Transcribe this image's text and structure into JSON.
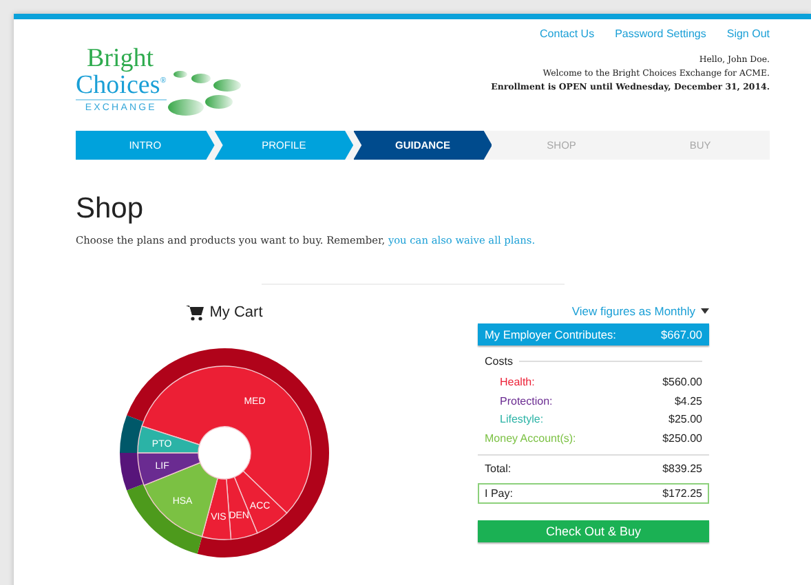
{
  "logo": {
    "line_1": "Bright",
    "line_2": "Choices",
    "mark": "®",
    "line_3": "EXCHANGE"
  },
  "top_links": [
    "Contact Us",
    "Password Settings",
    "Sign Out"
  ],
  "greeting": {
    "hello": "Hello, John Doe.",
    "welcome": "Welcome to the Bright Choices Exchange for ACME.",
    "enrollment": "Enrollment is OPEN until Wednesday, December 31, 2014."
  },
  "steps": [
    {
      "label": "INTRO",
      "kind": "done",
      "selected": false
    },
    {
      "label": "PROFILE",
      "kind": "done",
      "selected": false
    },
    {
      "label": "GUIDANCE",
      "kind": "current",
      "selected": true
    },
    {
      "label": "SHOP",
      "kind": "todo",
      "selected": false
    },
    {
      "label": "BUY",
      "kind": "todo",
      "selected": false
    }
  ],
  "page_title": "Shop",
  "intro": {
    "text": "Choose the plans and products you want to buy. Remember, ",
    "link": "you can also waive all plans."
  },
  "cart": {
    "title": "My Cart",
    "segments": [
      {
        "label": "MED",
        "color": "#ec1f35"
      },
      {
        "label": "ACC",
        "color": "#ec1f35"
      },
      {
        "label": "DEN",
        "color": "#ec1f35"
      },
      {
        "label": "VIS",
        "color": "#ec1f35"
      },
      {
        "label": "HSA",
        "color": "#7bc143"
      },
      {
        "label": "LIF",
        "color": "#6a2b91"
      },
      {
        "label": "PTO",
        "color": "#2bb3a6"
      }
    ]
  },
  "summary": {
    "view_toggle": "View figures as Monthly",
    "employer_label": "My Employer Contributes:",
    "employer_value": "$667.00",
    "costs_heading": "Costs",
    "costs": [
      {
        "label": "Health:",
        "value": "$560.00",
        "color": "#ec1f35",
        "kind": "sub"
      },
      {
        "label": "Protection:",
        "value": "$4.25",
        "color": "#6a2b91",
        "kind": "sub"
      },
      {
        "label": "Lifestyle:",
        "value": "$25.00",
        "color": "#2bb3a6",
        "kind": "sub"
      },
      {
        "label": "Money Account(s):",
        "value": "$250.00",
        "color": "#7bc143",
        "kind": "main"
      }
    ],
    "total_label": "Total:",
    "total_value": "$839.25",
    "pay_label": "I Pay:",
    "pay_value": "$172.25"
  },
  "checkout_button": "Check Out & Buy"
}
